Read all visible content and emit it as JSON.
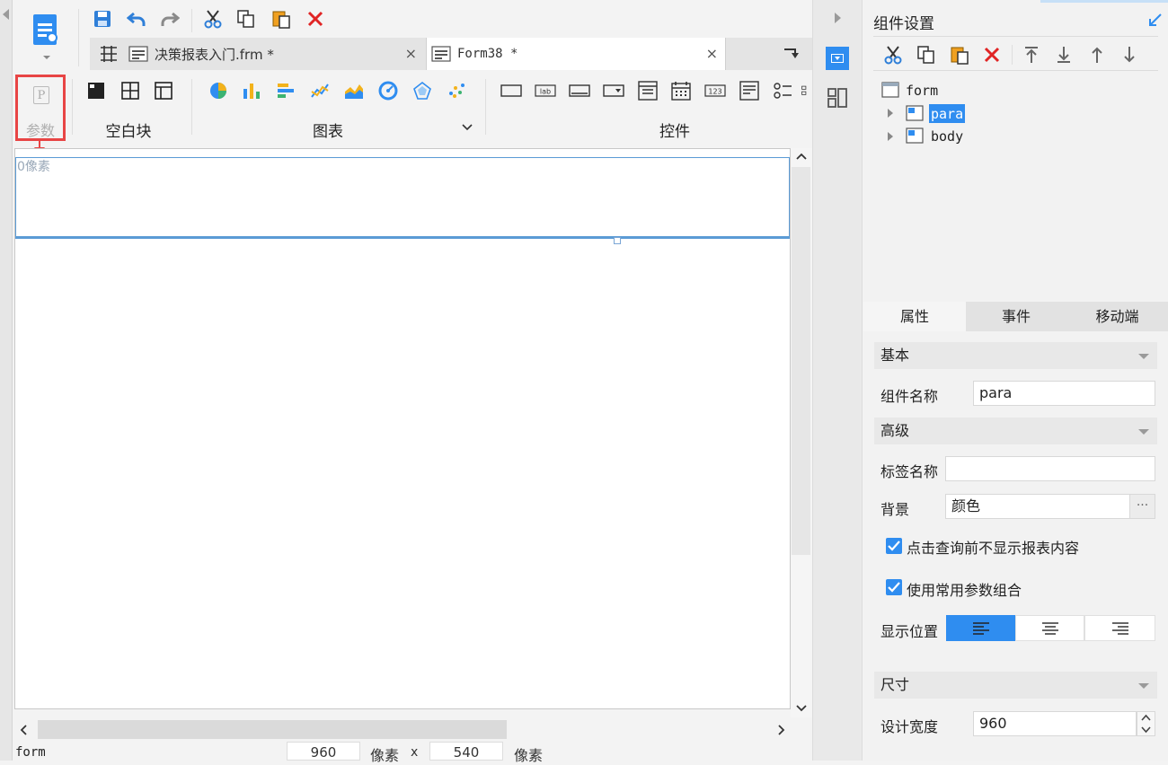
{
  "toolbar": {
    "tab1_label": "决策报表入门.frm *",
    "tab2_label": "Form38 *",
    "close_glyph": "×"
  },
  "palette": {
    "param_letter": "P",
    "param_label": "参数",
    "blank_group": "空白块",
    "chart_group": "图表",
    "control_group": "控件"
  },
  "canvas": {
    "ruler_text": "0像素"
  },
  "statusbar": {
    "name": "form",
    "width": "960",
    "unit1": "像素",
    "times": "x",
    "height": "540",
    "unit2": "像素"
  },
  "component_panel": {
    "title": "组件设置",
    "tree": {
      "root": "form",
      "child1": "para",
      "child2": "body"
    }
  },
  "prop_tabs": {
    "attr": "属性",
    "event": "事件",
    "mobile": "移动端"
  },
  "props": {
    "basic": "基本",
    "name_label": "组件名称",
    "name_value": "para",
    "advanced": "高级",
    "tag_label": "标签名称",
    "tag_value": "",
    "bg_label": "背景",
    "bg_value": "颜色",
    "bg_more": "···",
    "check1": "点击查询前不显示报表内容",
    "check2": "使用常用参数组合",
    "position_label": "显示位置",
    "size": "尺寸",
    "width_label": "设计宽度",
    "width_value": "960"
  },
  "colors": {
    "accent": "#2f8df0",
    "highlight_box": "#e84545",
    "selection_border": "#5b9bd5"
  }
}
